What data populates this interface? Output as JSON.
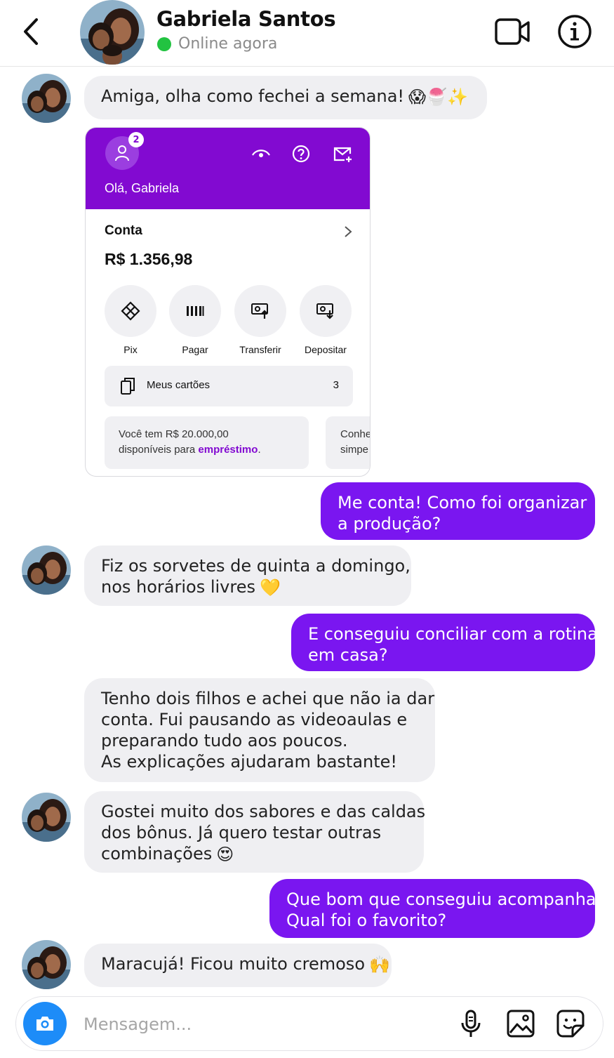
{
  "header": {
    "contact_name": "Gabriela Santos",
    "status_text": "Online agora",
    "status_color": "#22c341",
    "icons": [
      "back-chevron-icon",
      "video-call-icon",
      "info-icon"
    ]
  },
  "colors": {
    "outgoing_bubble": "#7a16f0",
    "incoming_bubble": "#efeff2",
    "bank_brand": "#820ad1",
    "camera_button": "#1d8cf8"
  },
  "messages": [
    {
      "from": "contact",
      "lines": [
        "Amiga, olha como fechei a semana!"
      ],
      "emoji": "😱🍧✨"
    },
    {
      "from": "me",
      "lines": [
        "Me conta! Como foi organizar",
        "a produção?"
      ]
    },
    {
      "from": "contact",
      "lines": [
        "Fiz os sorvetes de quinta a domingo,",
        "nos horários livres"
      ],
      "emoji": "💛"
    },
    {
      "from": "me",
      "lines": [
        "E conseguiu conciliar com a rotina",
        "em casa?"
      ]
    },
    {
      "from": "contact",
      "lines": [
        "Tenho dois filhos e achei que não ia dar",
        "conta. Fui pausando as videoaulas e",
        "preparando tudo aos poucos.",
        "As explicações ajudaram bastante!"
      ]
    },
    {
      "from": "contact",
      "lines": [
        "Gostei muito dos sabores e das caldas",
        "dos bônus. Já quero testar outras",
        "combinações"
      ],
      "emoji": "😍"
    },
    {
      "from": "me",
      "lines": [
        "Que bom que conseguiu acompanhar!",
        "Qual foi o favorito?"
      ]
    },
    {
      "from": "contact",
      "lines": [
        "Maracujá! Ficou muito cremoso"
      ],
      "emoji": "🙌"
    }
  ],
  "bank_screenshot": {
    "profile_badge": "2",
    "greeting": "Olá, Gabriela",
    "account_label": "Conta",
    "balance": "R$ 1.356,98",
    "actions": [
      {
        "label": "Pix",
        "icon": "pix-icon"
      },
      {
        "label": "Pagar",
        "icon": "barcode-icon"
      },
      {
        "label": "Transferir",
        "icon": "transfer-icon"
      },
      {
        "label": "Depositar",
        "icon": "deposit-icon"
      }
    ],
    "cards_label": "Meus cartões",
    "cards_count": "3",
    "loan_text_line1": "Você tem R$ 20.000,00",
    "loan_text_line2": "disponíveis para ",
    "loan_link": "empréstimo",
    "loan_suffix": ".",
    "promo_line1": "Conhe",
    "promo_line2": "simpe"
  },
  "composer": {
    "placeholder": "Mensagem...",
    "icons": [
      "camera-icon",
      "microphone-icon",
      "gallery-icon",
      "sticker-icon"
    ]
  }
}
